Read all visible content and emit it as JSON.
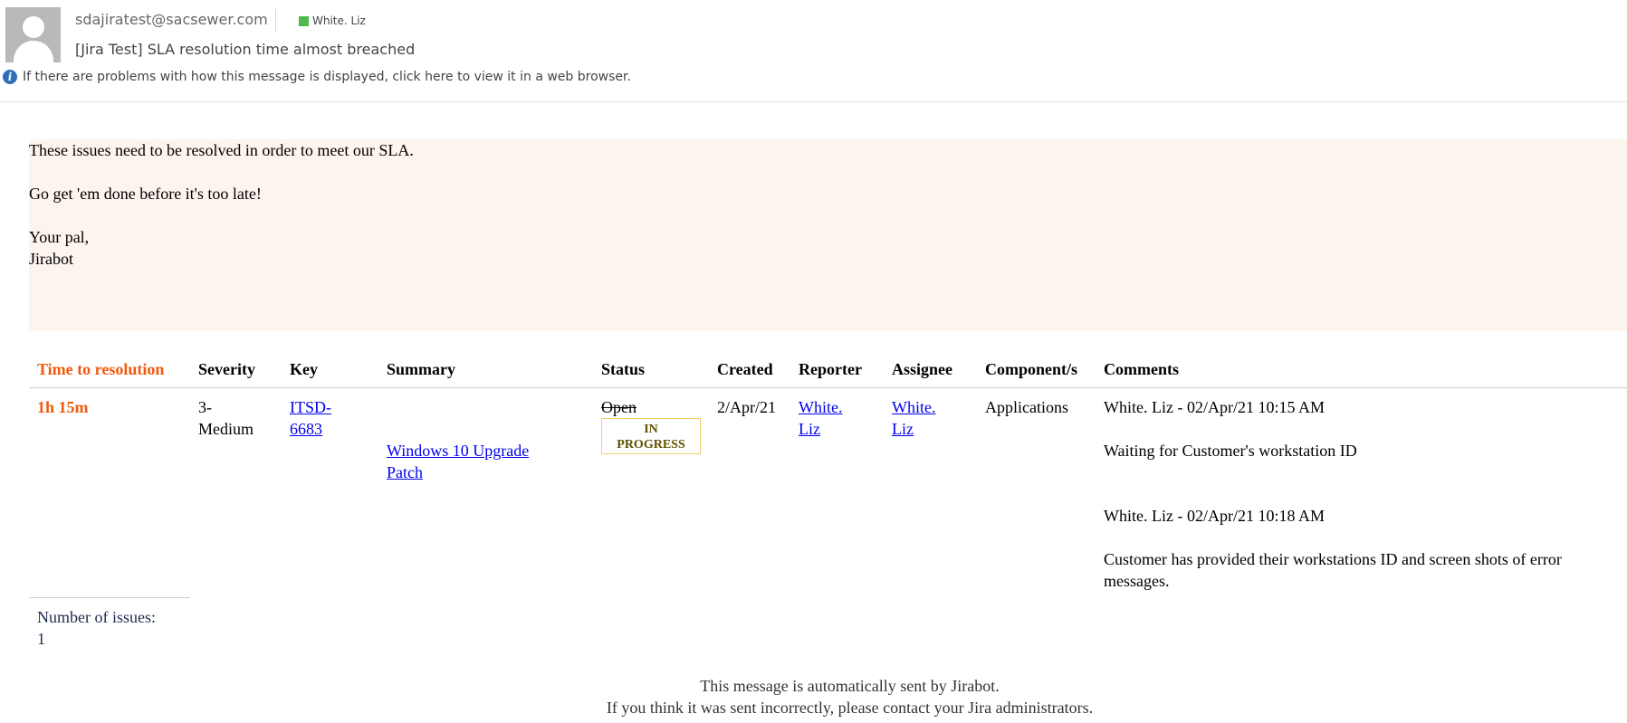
{
  "header": {
    "from": "sdajiratest@sacsewer.com",
    "category": "White. Liz",
    "category_color": "#4cbb4c",
    "subject": "[Jira Test] SLA resolution time almost breached",
    "info_text": "If there are problems with how this message is displayed, click here to view it in a web browser."
  },
  "banner": {
    "line1": "These issues need to be resolved in order to meet our SLA.",
    "line2": "Go get 'em done before it's too late!",
    "line3": "Your pal,",
    "line4": "Jirabot"
  },
  "table": {
    "headers": [
      "Time to resolution",
      "Severity",
      "Key",
      "Summary",
      "Status",
      "Created",
      "Reporter",
      "Assignee",
      "Component/s",
      "Comments"
    ],
    "rows": [
      {
        "time_to_resolution": "1h 15m",
        "severity_line1": "3-",
        "severity_line2": "Medium",
        "key_line1": "ITSD-",
        "key_line2": "6683",
        "summary_line1": "Windows 10 Upgrade",
        "summary_line2": "Patch",
        "status_old": "Open",
        "status_new_line1": "IN",
        "status_new_line2": "PROGRESS",
        "created": "2/Apr/21",
        "reporter_line1": "White.",
        "reporter_line2": "Liz",
        "assignee_line1": "White.",
        "assignee_line2": "Liz",
        "component": "Applications",
        "comments": [
          {
            "author": "White. Liz - 02/Apr/21 10:15 AM",
            "body": "Waiting for Customer's workstation ID"
          },
          {
            "author": "White. Liz - 02/Apr/21 10:18 AM",
            "body_line1": "Customer has provided their workstations ID and screen shots of error",
            "body_line2": "messages."
          }
        ]
      }
    ]
  },
  "summary": {
    "count_label": "Number of issues:",
    "count": "1"
  },
  "footer": {
    "line1": "This message is automatically sent by Jirabot.",
    "line2": "If you think it was sent incorrectly, please contact your Jira administrators."
  }
}
